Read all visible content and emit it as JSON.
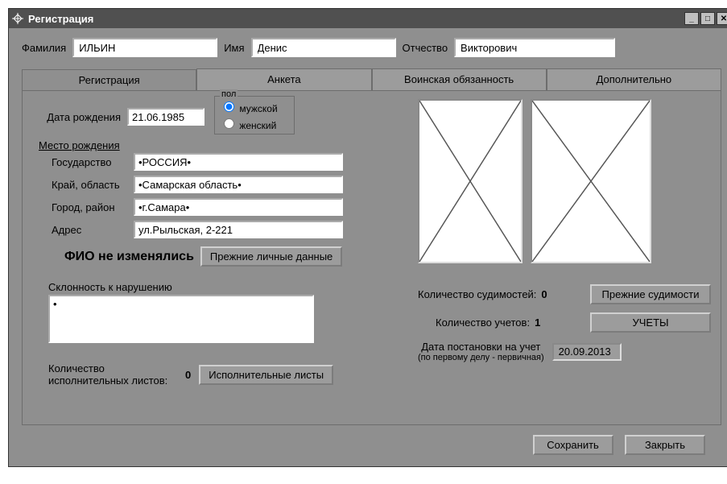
{
  "window": {
    "title": "Регистрация"
  },
  "labels": {
    "lastname": "Фамилия",
    "firstname": "Имя",
    "patronymic": "Отчество",
    "dob": "Дата рождения",
    "gender_legend": "пол",
    "gender_male": "мужской",
    "gender_female": "женский",
    "birthplace": "Место рождения",
    "country": "Государство",
    "region": "Край, область",
    "city": "Город, район",
    "address": "Адрес",
    "fio_unchanged": "ФИО не изменялись",
    "prev_personal": "Прежние личные данные",
    "violation_tendency": "Склонность к нарушению",
    "exec_sheets_count": "Количество исполнительных листов:",
    "exec_sheets_btn": "Исполнительные листы",
    "convictions_count": "Количество судимостей:",
    "prev_convictions": "Прежние судимости",
    "records_count": "Количество учетов:",
    "records_btn": "УЧЕТЫ",
    "reg_date": "Дата постановки на учет",
    "reg_date_sub": "(по первому делу - первичная)",
    "save": "Сохранить",
    "close": "Закрыть"
  },
  "tabs": [
    "Регистрация",
    "Анкета",
    "Воинская обязанность",
    "Дополнительно"
  ],
  "values": {
    "lastname": "ИЛЬИН",
    "firstname": "Денис",
    "patronymic": "Викторович",
    "dob": "21.06.1985",
    "gender": "male",
    "country": "•РОССИЯ•",
    "region": "•Самарская область•",
    "city": "•г.Самара•",
    "address": "ул.Рыльская, 2-221",
    "violation_tendency": "•",
    "exec_sheets_count": "0",
    "convictions_count": "0",
    "records_count": "1",
    "reg_date": "20.09.2013"
  }
}
